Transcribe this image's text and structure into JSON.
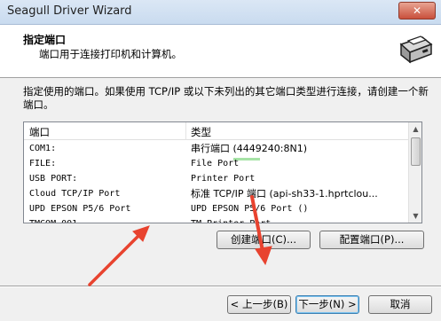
{
  "window": {
    "title": "Seagull Driver Wizard",
    "close_label": "✕"
  },
  "header": {
    "title": "指定端口",
    "subtitle": "端口用于连接打印机和计算机。",
    "icon": "printer-icon"
  },
  "description": "指定使用的端口。如果使用 TCP/IP 或以下未列出的其它端口类型进行连接，请创建一个新端口。",
  "port_list": {
    "columns": [
      "端口",
      "类型"
    ],
    "rows": [
      {
        "port": "COM1:",
        "type": "串行端口 (4449240:8N1)"
      },
      {
        "port": "FILE:",
        "type": "File Port"
      },
      {
        "port": "USB PORT:",
        "type": "Printer Port"
      },
      {
        "port": "Cloud TCP/IP Port",
        "type": "标准 TCP/IP 端口 (api-sh33-1.hprtclou..."
      },
      {
        "port": "UPD EPSON P5/6 Port",
        "type": "UPD EPSON P5/6 Port ()"
      },
      {
        "port": "TMCOM 001",
        "type": "TM Printer Port"
      }
    ]
  },
  "buttons": {
    "create_port": "创建端口(C)...",
    "configure_port": "配置端口(P)...",
    "back": "< 上一步(B)",
    "next": "下一步(N) >",
    "cancel": "取消"
  },
  "colors": {
    "annotation_arrow": "#e8432f",
    "selection_tick": "#6ad06a"
  }
}
